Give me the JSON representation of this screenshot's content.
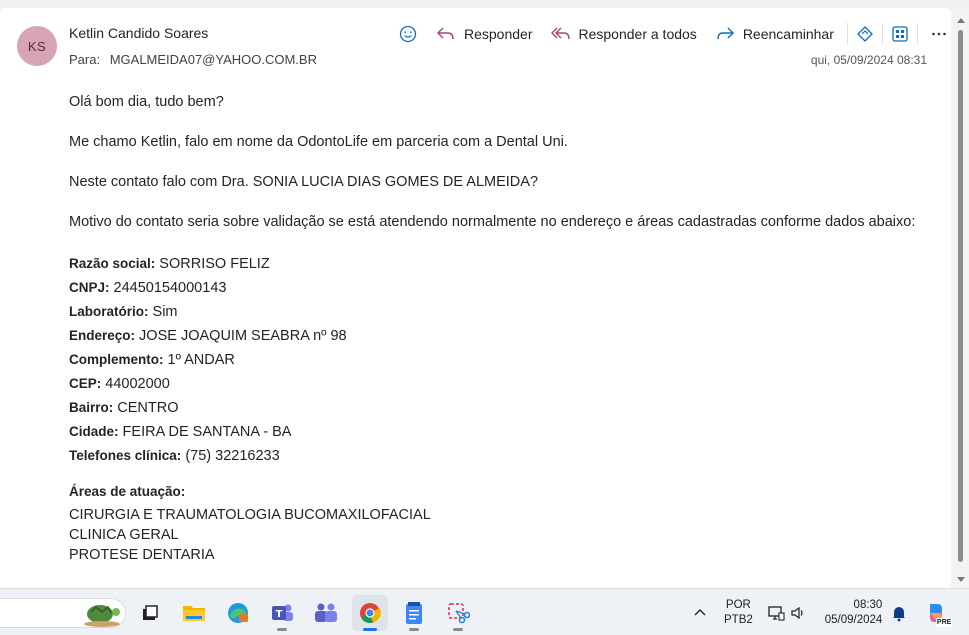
{
  "email": {
    "avatar_initials": "KS",
    "avatar_color": "#d6a4b2",
    "sender": "Ketlin Candido Soares",
    "to_label": "Para:",
    "to_address": "MGALMEIDA07@YAHOO.COM.BR",
    "date": "qui, 05/09/2024 08:31"
  },
  "toolbar": {
    "emoji_icon": "smiley-icon",
    "reply_label": "Responder",
    "reply_all_label": "Responder a todos",
    "forward_label": "Reencaminhar",
    "more_icon": "ellipsis-icon"
  },
  "body": {
    "greeting": "Olá bom dia, tudo bem?",
    "intro": "Me chamo Ketlin, falo em nome da OdontoLife em parceria com a Dental Uni.",
    "question": "Neste contato falo com Dra. SONIA LUCIA DIAS GOMES DE ALMEIDA?",
    "motive": "Motivo do contato seria sobre validação se está atendendo normalmente no endereço e áreas cadastradas conforme dados abaixo:",
    "fields": [
      {
        "label": "Razão social:",
        "value": " SORRISO FELIZ"
      },
      {
        "label": "CNPJ:",
        "value": " 24450154000143"
      },
      {
        "label": "Laboratório:",
        "value": " Sim"
      },
      {
        "label": "Endereço:",
        "value": " JOSE JOAQUIM SEABRA nº 98"
      },
      {
        "label": "Complemento:",
        "value": " 1º ANDAR"
      },
      {
        "label": "CEP:",
        "value": " 44002000"
      },
      {
        "label": "Bairro:",
        "value": " CENTRO"
      },
      {
        "label": "Cidade:",
        "value": " FEIRA DE SANTANA - BA"
      },
      {
        "label": "Telefones clínica:",
        "value": " (75) 32216233"
      }
    ],
    "areas_title": "Áreas de atuação:",
    "areas": [
      "CIRURGIA E TRAUMATOLOGIA BUCOMAXILOFACIAL",
      "CLINICA GERAL",
      "PROTESE DENTARIA"
    ]
  },
  "taskbar": {
    "lang_line1": "POR",
    "lang_line2": "PTB2",
    "time": "08:30",
    "date": "05/09/2024",
    "pre_badge": "PRE",
    "accent": "#1a73e8"
  }
}
